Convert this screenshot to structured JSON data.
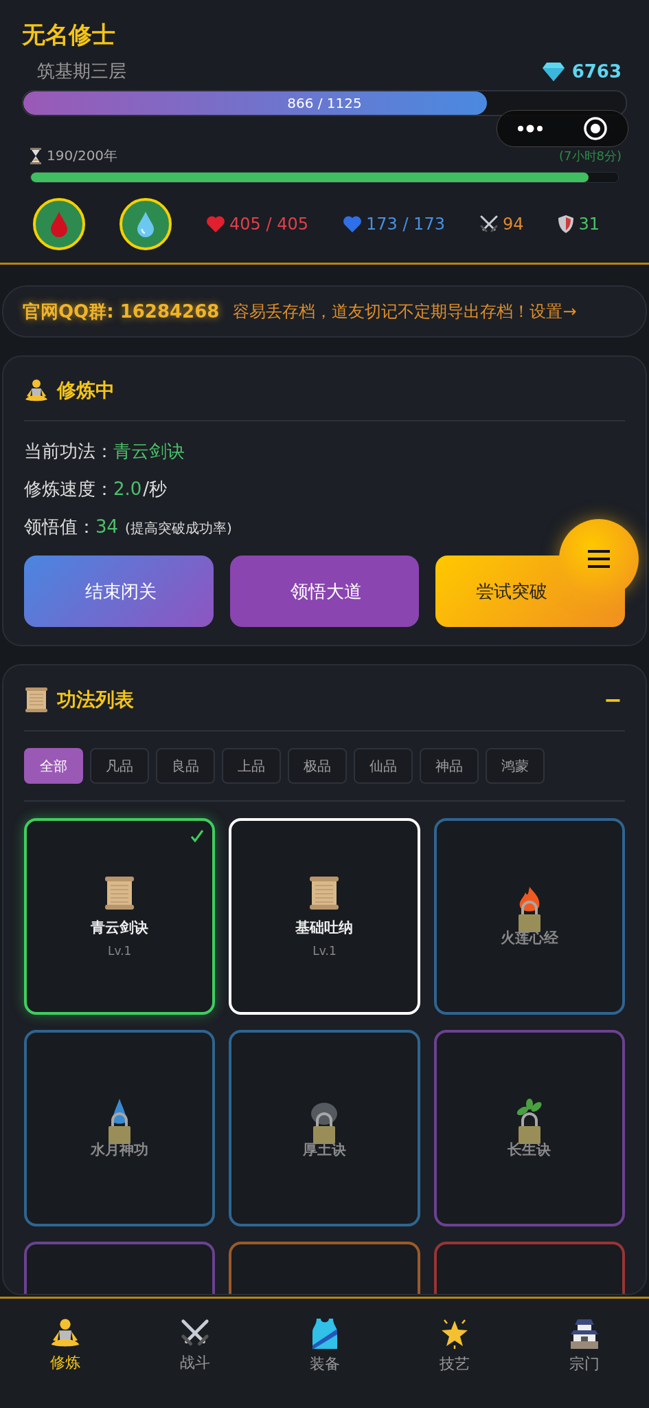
{
  "header": {
    "name": "无名修士",
    "realm": "筑基期三层",
    "gems": "6763"
  },
  "cultivation_bar": {
    "text": "866 / 1125",
    "level": 0.77
  },
  "lifespan": {
    "text": "190/200年",
    "remaining": "(7小时8分)",
    "level": 0.95
  },
  "stats": [
    {
      "kind": "hp",
      "value": "405 / 405"
    },
    {
      "kind": "mp",
      "value": "173 / 173"
    },
    {
      "kind": "attack",
      "value": "94"
    },
    {
      "kind": "defense",
      "value": "31"
    }
  ],
  "notice": {
    "group": "官网QQ群: 16284268",
    "message": "容易丢存档，道友切记不定期导出存档！设置→"
  },
  "cultivation": {
    "title": "修炼中",
    "lines": [
      {
        "label": "当前功法：",
        "value": "青云剑诀"
      },
      {
        "label": "修炼速度：",
        "value": "2.0",
        "unit": "/秒"
      },
      {
        "label": "领悟值：",
        "value": "34",
        "note": "(提高突破成功率)"
      }
    ],
    "buttons": [
      {
        "kind": "end",
        "label": "结束闭关"
      },
      {
        "kind": "insight",
        "label": "领悟大道"
      },
      {
        "kind": "breakthrough",
        "label": "尝试突破"
      }
    ]
  },
  "technique_list": {
    "title": "功法列表",
    "collapse": "−",
    "filters": [
      {
        "label": "全部",
        "selected": true
      },
      {
        "label": "凡品",
        "selected": false
      },
      {
        "label": "良品",
        "selected": false
      },
      {
        "label": "上品",
        "selected": false
      },
      {
        "label": "极品",
        "selected": false
      },
      {
        "label": "仙品",
        "selected": false
      },
      {
        "label": "神品",
        "selected": false
      },
      {
        "label": "鸿蒙",
        "selected": false
      }
    ],
    "cards": [
      {
        "kind": "learned",
        "name": "青云剑诀",
        "level_text": "Lv.1",
        "selected": true,
        "color": "#3ecf5e"
      },
      {
        "kind": "learned",
        "name": "基础吐纳",
        "level_text": "Lv.1",
        "selected": false,
        "color": "#ffffff"
      },
      {
        "kind": "locked",
        "name": "火莲心经",
        "selected": false,
        "color": "#2e6591"
      },
      {
        "kind": "locked",
        "name": "水月神功",
        "selected": false,
        "color": "#2e6591"
      },
      {
        "kind": "locked",
        "name": "厚土诀",
        "selected": false,
        "color": "#2e6591"
      },
      {
        "kind": "locked",
        "name": "长生诀",
        "selected": false,
        "color": "#6b4191"
      },
      {
        "kind": "locked",
        "selected": false,
        "color": "#6b4191"
      },
      {
        "kind": "locked",
        "selected": false,
        "color": "#9a5a2a"
      },
      {
        "kind": "locked",
        "selected": false,
        "color": "#9a3434"
      }
    ]
  },
  "nav": [
    {
      "label": "修炼",
      "selected": true
    },
    {
      "label": "战斗",
      "selected": false
    },
    {
      "label": "装备",
      "selected": false
    },
    {
      "label": "技艺",
      "selected": false
    },
    {
      "label": "宗门",
      "selected": false
    }
  ]
}
